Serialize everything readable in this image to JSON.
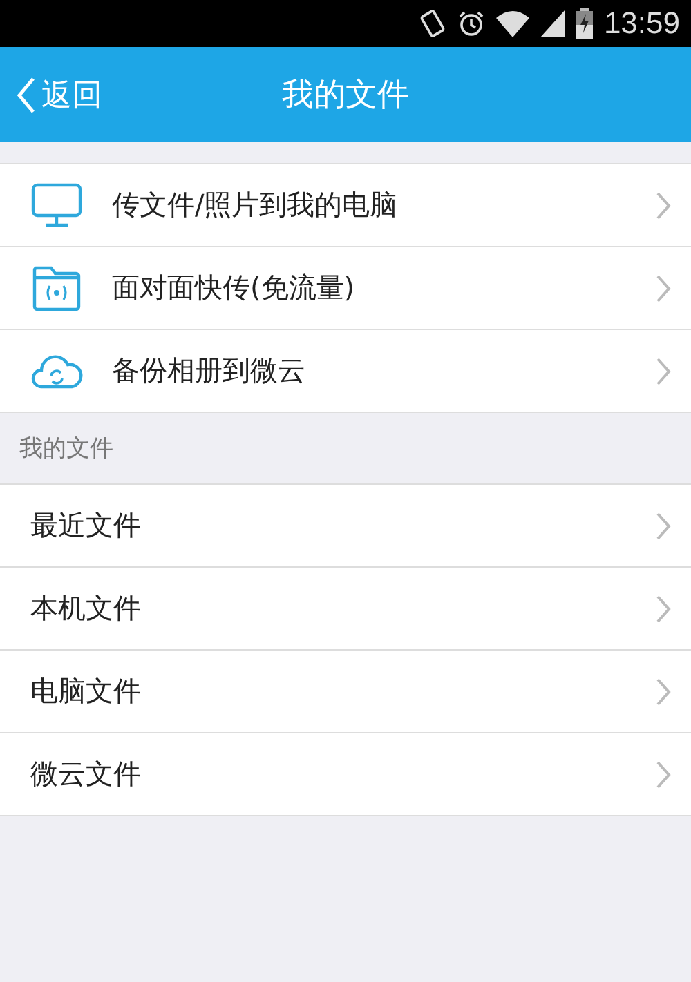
{
  "status_bar": {
    "time": "13:59"
  },
  "header": {
    "back": "返回",
    "title": "我的文件"
  },
  "actions": [
    {
      "kind": "monitor",
      "label": "传文件/照片到我的电脑"
    },
    {
      "kind": "folder",
      "label": "面对面快传(免流量)"
    },
    {
      "kind": "cloud",
      "label": "备份相册到微云"
    }
  ],
  "section": {
    "title": "我的文件",
    "items": [
      "最近文件",
      "本机文件",
      "电脑文件",
      "微云文件"
    ]
  }
}
